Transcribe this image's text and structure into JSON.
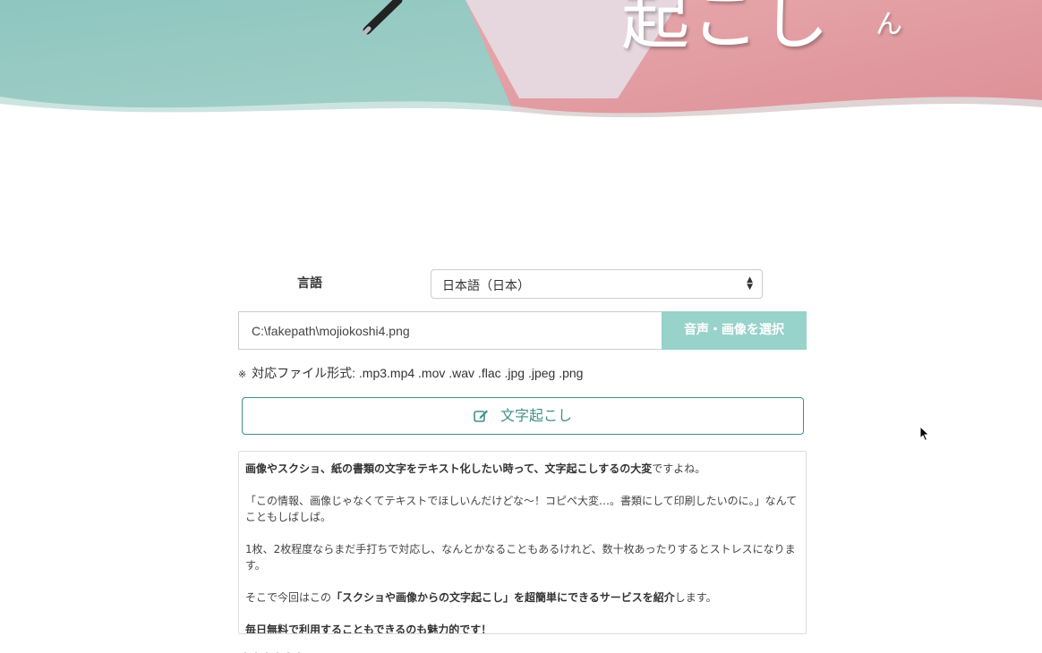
{
  "hero": {
    "title": "起こし",
    "title_sub": "ん",
    "colors": {
      "teal": "#a3cfc7",
      "pink": "#e39aa0",
      "lilac": "#e3d3db"
    }
  },
  "form": {
    "language_label": "言語",
    "language_selected": "日本語（日本）",
    "file_path": "C:\\fakepath\\mojiokoshi4.png",
    "file_button": "音声・画像を選択",
    "file_note_mark": "※",
    "file_note": "対応ファイル形式: .mp3.mp4 .mov .wav .flac .jpg .jpeg .png",
    "transcribe_button": "文字起こし",
    "accent_color": "#3f8f8a",
    "button_color": "#97d2cb"
  },
  "result": {
    "p1_bold": "画像やスクショ、紙の書類の文字をテキスト化したい時って、文字起こしするの大変",
    "p1_rest": "ですよね。",
    "p2": "「この情報、画像じゃなくてテキストでほしいんだけどな〜！コピペ大変…。書類にして印刷したいのに。」なんてこともしばしば。",
    "p3": "1枚、2枚程度ならまだ手打ちで対応し、なんとかなることもあるけれど、数十枚あったりするとストレスになります。",
    "p4_pre": "そこで今回はこの",
    "p4_bold": "「スクショや画像からの文字起こし」を超簡単にできるサービスを紹介",
    "p4_post": "します。",
    "p5_bold": "毎日無料で利用することもできるのも魅力的です！"
  },
  "below": {
    "text": "・・・・・・"
  }
}
